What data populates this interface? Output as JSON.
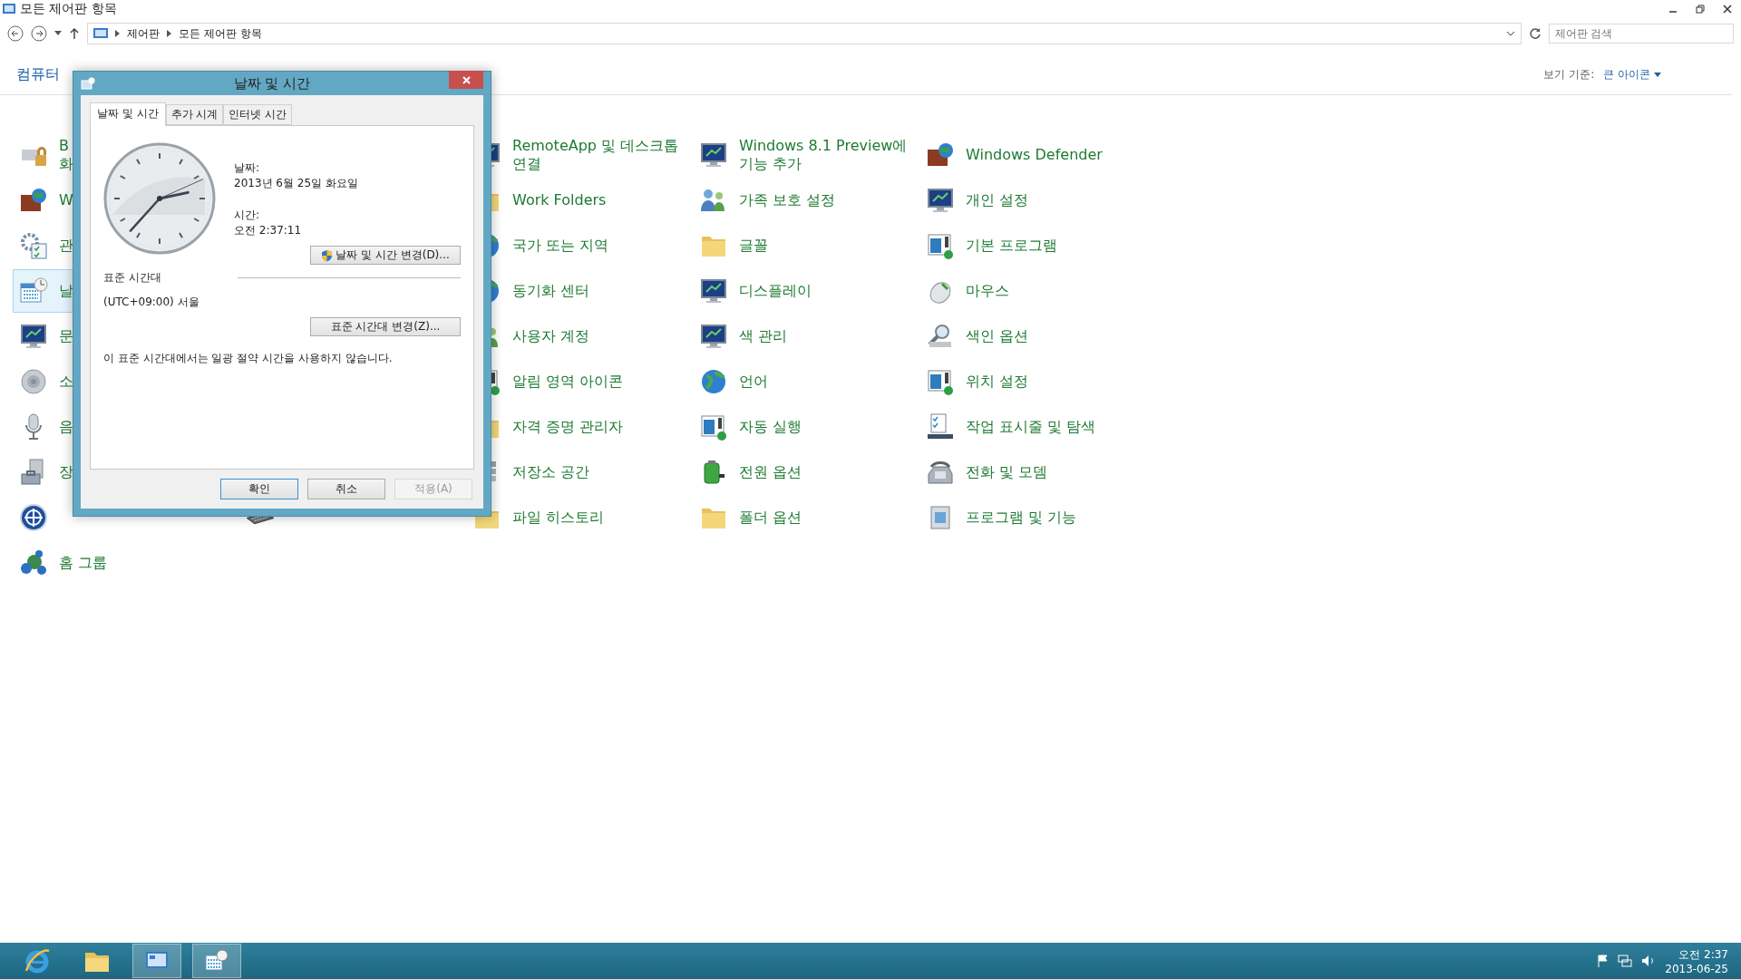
{
  "window": {
    "title": "모든 제어판 항목"
  },
  "address_bar": {
    "breadcrumbs": [
      "제어판",
      "모든 제어판 항목"
    ]
  },
  "search": {
    "placeholder": "제어판 검색"
  },
  "heading": "컴퓨터",
  "view_by": {
    "label": "보기 기준:",
    "value": "큰 아이콘"
  },
  "rows": [
    [
      {
        "lines": [
          "B",
          "화"
        ],
        "hovered": false
      },
      null,
      {
        "lines": [
          "RemoteApp 및 데스크톱",
          "연결"
        ],
        "hovered": false
      },
      {
        "lines": [
          "Windows 8.1 Preview에",
          "기능 추가"
        ],
        "hovered": false
      },
      {
        "lines": [
          "Windows Defender"
        ],
        "hovered": false
      }
    ],
    [
      {
        "lines": [
          "W"
        ],
        "hovered": false
      },
      null,
      {
        "lines": [
          "Work Folders"
        ],
        "hovered": false
      },
      {
        "lines": [
          "가족 보호 설정"
        ],
        "hovered": false
      },
      {
        "lines": [
          "개인 설정"
        ],
        "hovered": false
      }
    ],
    [
      {
        "lines": [
          "관"
        ],
        "hovered": false
      },
      null,
      {
        "lines": [
          "국가 또는 지역"
        ],
        "hovered": false
      },
      {
        "lines": [
          "글꼴"
        ],
        "hovered": false
      },
      {
        "lines": [
          "기본 프로그램"
        ],
        "hovered": false
      }
    ],
    [
      {
        "lines": [
          "날"
        ],
        "hovered": true
      },
      null,
      {
        "lines": [
          "동기화 센터"
        ],
        "hovered": false
      },
      {
        "lines": [
          "디스플레이"
        ],
        "hovered": false
      },
      {
        "lines": [
          "마우스"
        ],
        "hovered": false
      }
    ],
    [
      {
        "lines": [
          "문"
        ],
        "hovered": false
      },
      null,
      {
        "lines": [
          "사용자 계정"
        ],
        "hovered": false
      },
      {
        "lines": [
          "색 관리"
        ],
        "hovered": false
      },
      {
        "lines": [
          "색인 옵션"
        ],
        "hovered": false
      }
    ],
    [
      {
        "lines": [
          "소"
        ],
        "hovered": false
      },
      null,
      {
        "lines": [
          "알림 영역 아이콘"
        ],
        "hovered": false
      },
      {
        "lines": [
          "언어"
        ],
        "hovered": false
      },
      {
        "lines": [
          "위치 설정"
        ],
        "hovered": false
      }
    ],
    [
      {
        "lines": [
          "음"
        ],
        "hovered": false
      },
      null,
      {
        "lines": [
          "자격 증명 관리자"
        ],
        "hovered": false
      },
      {
        "lines": [
          "자동 실행"
        ],
        "hovered": false
      },
      {
        "lines": [
          "작업 표시줄 및 탐색"
        ],
        "hovered": false
      }
    ],
    [
      {
        "lines": [
          "장"
        ],
        "hovered": false
      },
      null,
      {
        "lines": [
          "저장소 공간"
        ],
        "hovered": false
      },
      {
        "lines": [
          "전원 옵션"
        ],
        "hovered": false
      },
      {
        "lines": [
          "전화 및 모뎀"
        ],
        "hovered": false
      }
    ],
    [
      {
        "hovered": false
      },
      {
        "hovered": false
      },
      {
        "lines": [
          "파일 히스토리"
        ],
        "hovered": false
      },
      {
        "lines": [
          "폴더 옵션"
        ],
        "hovered": false
      },
      {
        "lines": [
          "프로그램 및 기능"
        ],
        "hovered": false
      }
    ],
    [
      {
        "lines": [
          "홈 그룹"
        ],
        "hovered": false
      }
    ]
  ],
  "dialog": {
    "title": "날짜 및 시간",
    "tabs": [
      {
        "label": "날짜 및 시간",
        "selected": true
      },
      {
        "label": "추가 시계",
        "selected": false
      },
      {
        "label": "인터넷 시간",
        "selected": false
      }
    ],
    "date_label": "날짜:",
    "date": "2013년 6월 25일 화요일",
    "time_label": "시간:",
    "time": "오전 2:37:11",
    "change_datetime_button": "날짜 및 시간 변경(D)...",
    "timezone_heading": "표준 시간대",
    "timezone": "(UTC+09:00) 서울",
    "change_timezone_button": "표준 시간대 변경(Z)...",
    "dst_note": "이 표준 시간대에서는 일광 절약 시간을 사용하지 않습니다.",
    "buttons": [
      {
        "label": "확인",
        "default": true,
        "disabled": false
      },
      {
        "label": "취소",
        "default": false,
        "disabled": false
      },
      {
        "label": "적용(A)",
        "default": false,
        "disabled": true
      }
    ]
  },
  "taskbar": {
    "apps": [
      {
        "selected": false
      },
      {
        "selected": false
      },
      {
        "selected": true
      },
      {
        "selected": true
      }
    ],
    "clock": {
      "time": "오전 2:37",
      "date": "2013-06-25"
    }
  }
}
